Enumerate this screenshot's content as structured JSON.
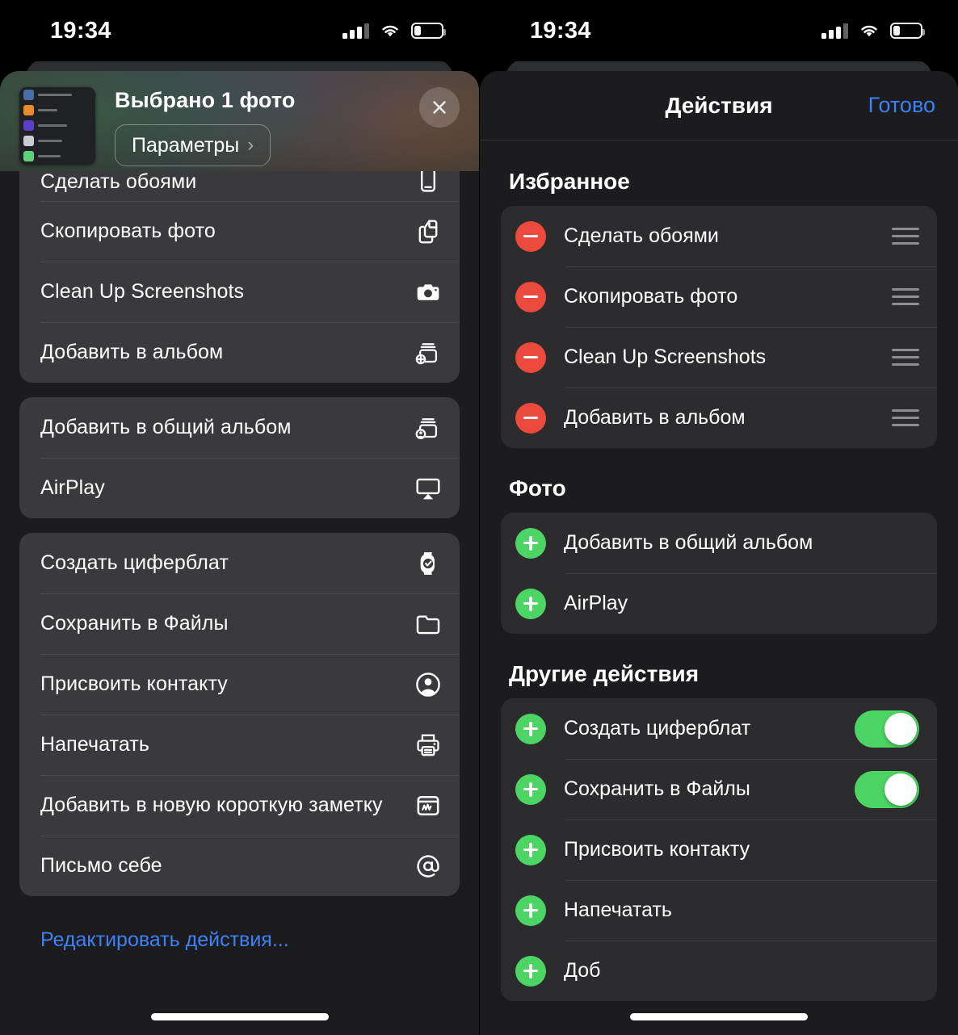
{
  "status_bar": {
    "time": "19:34",
    "cellular_icon": "cellular-bars-icon",
    "wifi_icon": "wifi-icon",
    "battery_icon": "battery-icon",
    "battery_level_percent": 26
  },
  "colors": {
    "accent_blue": "#3b82f6",
    "remove_red": "#eb4a3c",
    "add_green": "#4cd464",
    "toggle_on_green": "#4cd464",
    "sheet_bg": "#1c1c1e",
    "group_bg_left": "#3a3a3c",
    "group_bg_right": "#2c2c2e",
    "text_primary": "#ffffff",
    "handle_gray": "#8e8e93"
  },
  "left_panel": {
    "share_sheet": {
      "title": "Выбрано 1 фото",
      "options_button_label": "Параметры",
      "options_chevron": "chevron-right-icon",
      "close_icon": "close-icon",
      "thumbnail_name": "selected-photo-thumbnail"
    },
    "groups": [
      {
        "group_name": "photo-actions-group",
        "items": [
          {
            "label": "Сделать обоями",
            "icon": "wallpaper-iphone-icon"
          },
          {
            "label": "Скопировать фото",
            "icon": "copy-documents-icon"
          },
          {
            "label": "Clean Up Screenshots",
            "icon": "camera-icon"
          },
          {
            "label": "Добавить в альбом",
            "icon": "add-to-album-icon"
          }
        ]
      },
      {
        "group_name": "sharing-group",
        "items": [
          {
            "label": "Добавить в общий альбом",
            "icon": "shared-album-icon"
          },
          {
            "label": "AirPlay",
            "icon": "airplay-icon"
          }
        ]
      },
      {
        "group_name": "other-actions-group",
        "items": [
          {
            "label": "Создать циферблат",
            "icon": "watch-face-icon"
          },
          {
            "label": "Сохранить в Файлы",
            "icon": "folder-icon"
          },
          {
            "label": "Присвоить контакту",
            "icon": "contact-person-icon"
          },
          {
            "label": "Напечатать",
            "icon": "printer-icon"
          },
          {
            "label": "Добавить в новую короткую заметку",
            "icon": "quick-note-icon"
          },
          {
            "label": "Письмо себе",
            "icon": "at-sign-icon"
          }
        ]
      }
    ],
    "edit_actions_link": "Редактировать действия..."
  },
  "right_panel": {
    "nav": {
      "title": "Действия",
      "done_label": "Готово"
    },
    "sections": [
      {
        "title": "Избранное",
        "section_name": "favorites-section",
        "row_type": "favorite",
        "items": [
          {
            "label": "Сделать обоями",
            "badge": "remove",
            "control": "drag-handle"
          },
          {
            "label": "Скопировать фото",
            "badge": "remove",
            "control": "drag-handle"
          },
          {
            "label": "Clean Up Screenshots",
            "badge": "remove",
            "control": "drag-handle"
          },
          {
            "label": "Добавить в альбом",
            "badge": "remove",
            "control": "drag-handle"
          }
        ]
      },
      {
        "title": "Фото",
        "section_name": "photos-section",
        "row_type": "available",
        "items": [
          {
            "label": "Добавить в общий альбом",
            "badge": "add",
            "control": "none"
          },
          {
            "label": "AirPlay",
            "badge": "add",
            "control": "none"
          }
        ]
      },
      {
        "title": "Другие действия",
        "section_name": "other-actions-section",
        "row_type": "available",
        "items": [
          {
            "label": "Создать циферблат",
            "badge": "add",
            "control": "toggle",
            "toggle_on": true
          },
          {
            "label": "Сохранить в Файлы",
            "badge": "add",
            "control": "toggle",
            "toggle_on": true
          },
          {
            "label": "Присвоить контакту",
            "badge": "add",
            "control": "none"
          },
          {
            "label": "Напечатать",
            "badge": "add",
            "control": "none"
          },
          {
            "label": "Доб",
            "badge": "add",
            "control": "none"
          }
        ]
      }
    ]
  }
}
